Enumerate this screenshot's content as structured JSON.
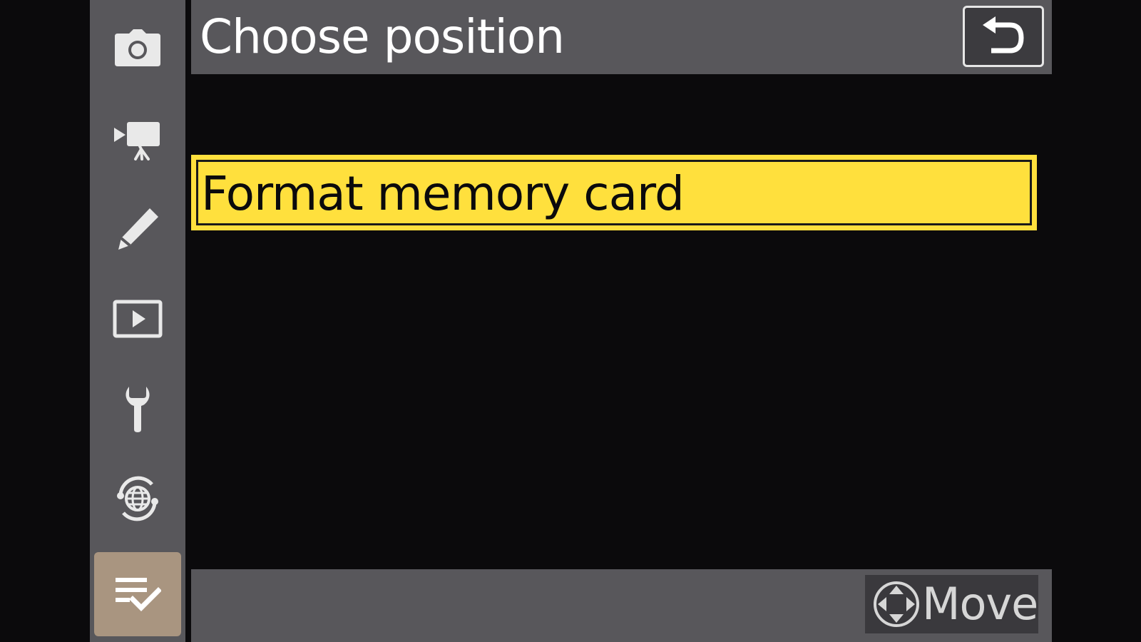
{
  "header": {
    "title": "Choose position",
    "back_icon": "return-arrow-icon"
  },
  "rail": {
    "items": [
      {
        "name": "photo-shooting-menu",
        "icon": "camera-icon",
        "selected": false
      },
      {
        "name": "movie-recording-menu",
        "icon": "movie-camera-icon",
        "selected": false
      },
      {
        "name": "custom-settings-menu",
        "icon": "pencil-icon",
        "selected": false
      },
      {
        "name": "playback-menu",
        "icon": "playback-icon",
        "selected": false
      },
      {
        "name": "setup-menu",
        "icon": "wrench-icon",
        "selected": false
      },
      {
        "name": "network-menu",
        "icon": "network-globe-icon",
        "selected": false
      },
      {
        "name": "my-menu",
        "icon": "my-menu-checklist-icon",
        "selected": true
      }
    ]
  },
  "list": {
    "items": [
      {
        "label": "Format memory card",
        "highlighted": true
      }
    ]
  },
  "footer": {
    "move_label": "Move",
    "move_icon": "multi-selector-icon"
  },
  "colors": {
    "highlight": "#ffe03d",
    "bar": "#58575b",
    "rail_selected": "#a99580",
    "background": "#0b0a0c"
  }
}
